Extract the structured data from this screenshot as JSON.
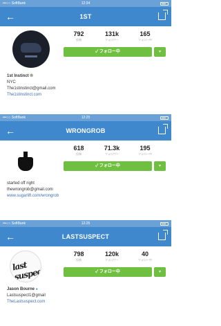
{
  "colors": {
    "nav": "#3f88cd",
    "status": "#6aa2d8",
    "follow": "#6fbf40",
    "link": "#3f6fb0"
  },
  "icons": {
    "back": "arrow-left-icon",
    "share": "share-icon",
    "more": "caret-down-icon"
  },
  "status_bar": {
    "carrier": "•••○○ SoftBank",
    "battery": "battery-icon"
  },
  "screens": [
    {
      "time": "12:34",
      "title": "1ST",
      "stats": {
        "posts": "792",
        "followers": "131k",
        "following": "165"
      },
      "stat_labels": {
        "posts": "投稿",
        "followers": "フォロワー",
        "following": "フォロー中"
      },
      "follow_label": "✓ フォロー中",
      "more_label": "▾",
      "bio": {
        "name": "1st Instinct ®",
        "lines": [
          "NYC",
          "The1stinstinct@gmail.com"
        ],
        "link": "The1stinstinct.com"
      }
    },
    {
      "time": "12:25",
      "title": "WRONGROB",
      "stats": {
        "posts": "618",
        "followers": "71.3k",
        "following": "195"
      },
      "stat_labels": {
        "posts": "投稿",
        "followers": "フォロワー",
        "following": "フォロー中"
      },
      "follow_label": "✓ フォロー中",
      "more_label": "▾",
      "bio": {
        "lines": [
          "started off right",
          "thewrongrob@gmail.com"
        ],
        "link": "www.sugarlift.com/wrongrob"
      }
    },
    {
      "time": "12:25",
      "title": "LASTSUSPECT",
      "stats": {
        "posts": "798",
        "followers": "120k",
        "following": "40"
      },
      "stat_labels": {
        "posts": "投稿",
        "followers": "フォロワー",
        "following": "フォロー中"
      },
      "follow_label": "✓ フォロー中",
      "more_label": "▾",
      "avatar_text": "last suspect",
      "bio": {
        "name": "Jason Bourne",
        "verified": "●",
        "lines": [
          "Lastsuspect1@gmail"
        ],
        "link": "TheLastsuspect.com"
      }
    }
  ]
}
